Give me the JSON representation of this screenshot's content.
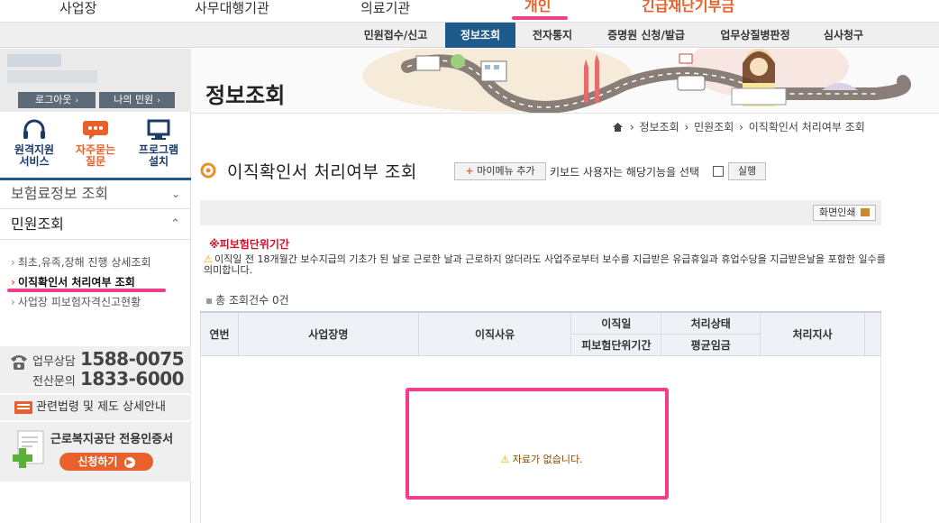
{
  "topnav": {
    "items": [
      {
        "label": "사업장"
      },
      {
        "label": "사무대행기관"
      },
      {
        "label": "의료기관"
      },
      {
        "label": "개인"
      },
      {
        "label": "긴급재난기부금"
      }
    ]
  },
  "subnav": {
    "items": [
      {
        "label": "민원접수/신고"
      },
      {
        "label": "정보조회"
      },
      {
        "label": "전자통지"
      },
      {
        "label": "증명원 신청/발급"
      },
      {
        "label": "업무상질병판정"
      },
      {
        "label": "심사청구"
      }
    ]
  },
  "sidebar": {
    "logout_label": "로그아웃",
    "myinfo_label": "나의 민원",
    "quick": [
      {
        "line1": "원격지원",
        "line2": "서비스"
      },
      {
        "line1": "자주묻는",
        "line2": "질문"
      },
      {
        "line1": "프로그램",
        "line2": "설치"
      }
    ],
    "menu_insurance": "보험료정보 조회",
    "menu_civil": "민원조회",
    "submenu": [
      {
        "label": "최초,유족,장해 진행 상세조회"
      },
      {
        "label": "이직확인서 처리여부 조회"
      },
      {
        "label": "사업장 피보험자격신고현황"
      }
    ],
    "contact": {
      "work_label": "업무상담",
      "work_num": "1588-0075",
      "it_label": "전산문의",
      "it_num": "1833-6000"
    },
    "law_label": "관련법령 및 제도 상세안내",
    "cert_title": "근로복지공단 전용인증서",
    "cert_btn": "신청하기"
  },
  "banner": {
    "title": "정보조회"
  },
  "breadcrumb": [
    "정보조회",
    "민원조회",
    "이직확인서 처리여부 조회"
  ],
  "page": {
    "title": "이직확인서 처리여부 조회",
    "mymenu_btn": "마이메뉴 추가",
    "kbd_label": "키보드 사용자는 해당기능을 선택",
    "run_btn": "실행",
    "print_btn": "화면인쇄",
    "notice_title": "※피보험단위기간",
    "notice_text": "이직일 전 18개월간 보수지급의 기초가 된 날로 근로한 날과 근로하지 않더라도 사업주로부터 보수를 지급받은 유급휴일과 휴업수당을 지급받은날을 포함한 일수를 의미합니다.",
    "total": "총 조회건수 0건"
  },
  "table": {
    "h_no": "연번",
    "h_company": "사업장명",
    "h_reason": "이직사유",
    "h_date": "이직일",
    "h_period": "피보험단위기간",
    "h_status": "처리상태",
    "h_wage": "평균임금",
    "h_branch": "처리지사",
    "empty_msg": "자료가 없습니다."
  },
  "colors": {
    "accent": "#e8612c",
    "highlight": "#ee3e8c",
    "navy": "#1e5b8a"
  }
}
